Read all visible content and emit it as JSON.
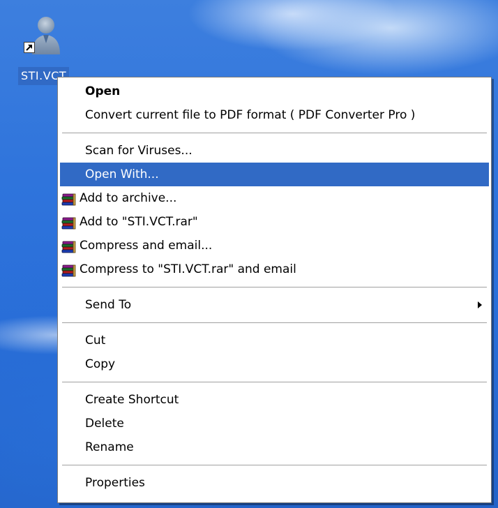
{
  "desktop": {
    "icon": {
      "name": "person-shortcut-icon",
      "label": "STI.VCT"
    }
  },
  "context_menu": {
    "items": [
      {
        "label": "Open",
        "bold": true
      },
      {
        "label": "Convert current file to PDF format ( PDF Converter Pro )"
      },
      {
        "label": "Scan for Viruses..."
      },
      {
        "label": "Open With...",
        "highlighted": true
      },
      {
        "label": "Add to archive...",
        "icon": "winrar-books-icon"
      },
      {
        "label": "Add to \"STI.VCT.rar\"",
        "icon": "winrar-books-icon"
      },
      {
        "label": "Compress and email...",
        "icon": "winrar-books-icon"
      },
      {
        "label": "Compress to \"STI.VCT.rar\" and email",
        "icon": "winrar-books-icon"
      },
      {
        "label": "Send To",
        "has_submenu": true
      },
      {
        "label": "Cut"
      },
      {
        "label": "Copy"
      },
      {
        "label": "Create Shortcut"
      },
      {
        "label": "Delete"
      },
      {
        "label": "Rename"
      },
      {
        "label": "Properties"
      }
    ]
  },
  "colors": {
    "highlight": "#316ac5",
    "menu_background": "#ffffff",
    "desktop_blue": "#2f74dc"
  }
}
